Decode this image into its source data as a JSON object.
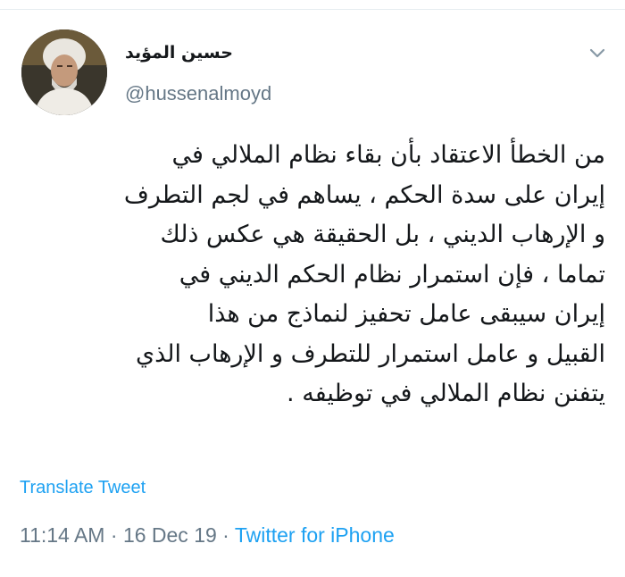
{
  "author": {
    "display_name": "حسين المؤيد",
    "handle": "@hussenalmoyd"
  },
  "tweet": {
    "lines": [
      "من الخطأ الاعتقاد بأن بقاء نظام الملالي في",
      "إيران على سدة الحكم ، يساهم في لجم التطرف",
      "و الإرهاب الديني ، بل الحقيقة هي عكس ذلك",
      "تماما ، فإن استمرار  نظام الحكم الديني في",
      "إيران سيبقى عامل تحفيز  لنماذج من هذا",
      "القبيل و عامل استمرار للتطرف و الإرهاب الذي",
      "يتفنن نظام الملالي في توظيفه ."
    ],
    "translate_label": "Translate Tweet",
    "time": "11:14 AM",
    "separator": " · ",
    "date": "16 Dec 19",
    "source": "Twitter for iPhone"
  },
  "icons": {
    "menu": "chevron-down-icon",
    "avatar": "user-avatar"
  },
  "colors": {
    "link": "#1da1f2",
    "secondary": "#657786",
    "text": "#14171a"
  }
}
